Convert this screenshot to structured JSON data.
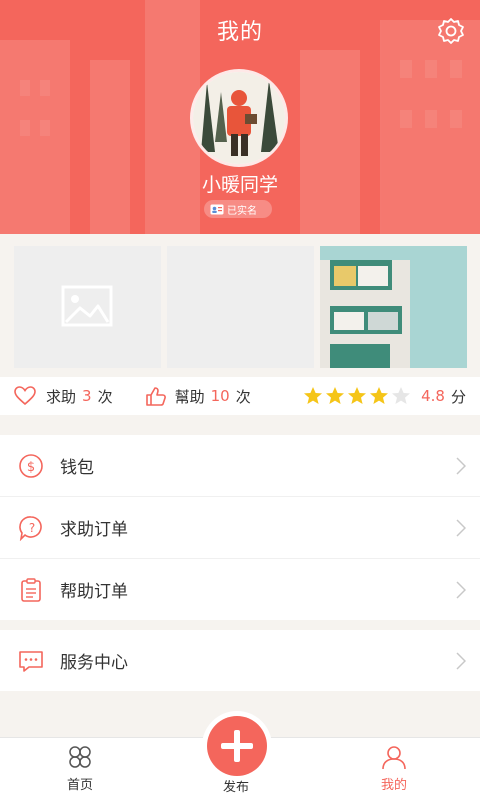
{
  "header": {
    "title": "我的",
    "username": "小暖同学",
    "verified_label": "已实名"
  },
  "stats": {
    "help_request_label": "求助",
    "help_request_count": "3",
    "help_request_unit": "次",
    "helped_label": "幫助",
    "helped_count": "10",
    "helped_unit": "次",
    "rating_value": "4.8",
    "rating_unit": "分",
    "rating_stars": 4,
    "rating_max": 5
  },
  "menu": {
    "wallet": "钱包",
    "request_orders": "求助订单",
    "help_orders": "帮助订单",
    "service_center": "服务中心"
  },
  "tabbar": {
    "home": "首页",
    "publish": "发布",
    "mine": "我的"
  },
  "colors": {
    "accent": "#f4665c",
    "star_on": "#f5c518",
    "star_off": "#e6e6e6"
  }
}
